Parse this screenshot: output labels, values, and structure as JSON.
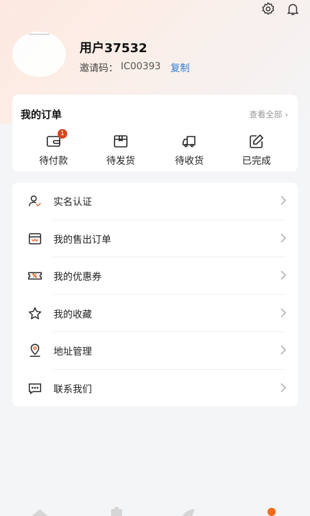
{
  "header": {
    "username": "用户37532",
    "invite_label": "邀请码：",
    "invite_code": "IC00393",
    "copy_label": "复制"
  },
  "orders": {
    "title": "我的订单",
    "view_all": "查看全部",
    "items": [
      {
        "label": "待付款",
        "icon": "wallet-icon",
        "badge": "1"
      },
      {
        "label": "待发货",
        "icon": "package-icon"
      },
      {
        "label": "待收货",
        "icon": "truck-icon"
      },
      {
        "label": "已完成",
        "icon": "edit-done-icon"
      }
    ]
  },
  "menu": {
    "items": [
      {
        "label": "实名认证",
        "icon": "user-verify-icon"
      },
      {
        "label": "我的售出订单",
        "icon": "sold-orders-icon"
      },
      {
        "label": "我的优惠券",
        "icon": "coupon-icon"
      },
      {
        "label": "我的收藏",
        "icon": "star-icon"
      },
      {
        "label": "地址管理",
        "icon": "location-icon"
      },
      {
        "label": "联系我们",
        "icon": "message-icon"
      }
    ]
  },
  "colors": {
    "accent": "#2f7fd8",
    "badge": "#d94420",
    "tab_active": "#f26b1d"
  }
}
